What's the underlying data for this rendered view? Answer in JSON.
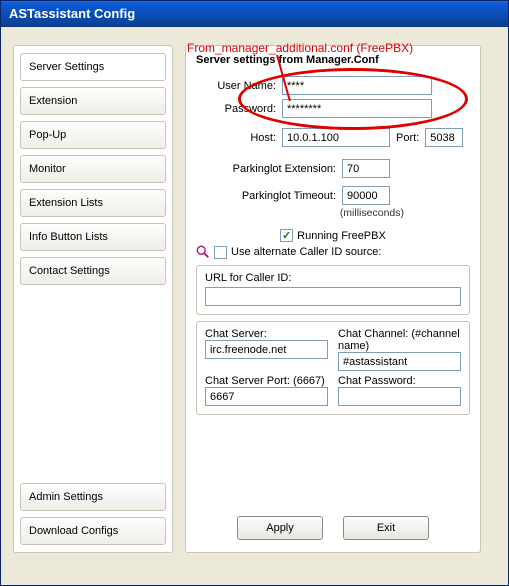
{
  "window_title": "ASTassistant Config",
  "annotation_text": "From_manager_additional.conf (FreePBX)",
  "sidebar": {
    "items": [
      "Server Settings",
      "Extension",
      "Pop-Up",
      "Monitor",
      "Extension Lists",
      "Info Button Lists",
      "Contact Settings"
    ],
    "bottom_items": [
      "Admin Settings",
      "Download Configs"
    ],
    "selected_index": 0
  },
  "main": {
    "heading": "Server settings from Manager.Conf",
    "labels": {
      "username": "User Name:",
      "password": "Password:",
      "host": "Host:",
      "port": "Port:",
      "pl_ext": "Parkinglot Extension:",
      "pl_timeout": "Parkinglot Timeout:",
      "ms": "(milliseconds)",
      "running": "Running FreePBX",
      "altcid": "Use alternate Caller ID source:",
      "url": "URL for Caller ID:",
      "chat_server": "Chat Server:",
      "chat_channel": "Chat Channel: (#channel name)",
      "chat_port": "Chat Server Port: (6667)",
      "chat_pass": "Chat Password:",
      "apply": "Apply",
      "exit": "Exit"
    },
    "values": {
      "username": "****",
      "password": "********",
      "host": "10.0.1.100",
      "port": "5038",
      "pl_ext": "70",
      "pl_timeout": "90000",
      "running_checked": true,
      "altcid_checked": false,
      "url": "",
      "chat_server": "irc.freenode.net",
      "chat_channel": "#astassistant",
      "chat_port": "6667",
      "chat_pass": ""
    }
  }
}
